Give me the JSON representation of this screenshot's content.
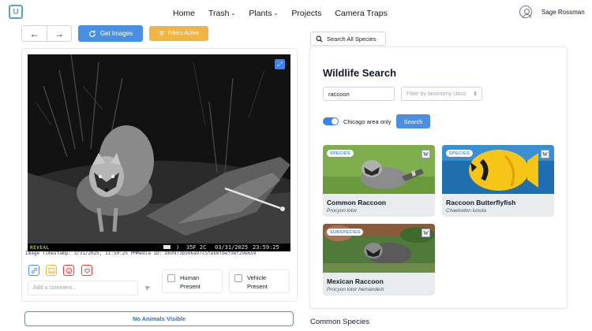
{
  "nav": {
    "logo_text": "U",
    "links": [
      {
        "label": "Home",
        "has_caret": false
      },
      {
        "label": "Trash",
        "has_caret": true
      },
      {
        "label": "Plants",
        "has_caret": true
      },
      {
        "label": "Projects",
        "has_caret": false
      },
      {
        "label": "Camera Traps",
        "has_caret": false
      }
    ],
    "caret_glyph": "⌄",
    "user_name": "Sage Rossman"
  },
  "toolbar": {
    "back_glyph": "←",
    "forward_glyph": "→",
    "get_images_label": "Get Images",
    "filters_label": "Filters Active",
    "get_images_color": "#4a90e2",
    "filters_color": "#f2b544"
  },
  "camera": {
    "brand": "REVEAL",
    "moon_glyph": ")",
    "temperature": "35F 2C",
    "date": "03/31/2025",
    "time": "23:59:25",
    "expand_icon": "expand-icon"
  },
  "image_meta": "Image Timestamp: 3/31/2025, 11:59:25 PMMedia ID: b69971b506a97c5feb8fbef98f29e659",
  "actions": {
    "icons": [
      "link-icon",
      "image-icon",
      "smile-icon",
      "heart-icon"
    ],
    "comment_placeholder": "Add a comment...",
    "human_present": "Human Present",
    "vehicle_present": "Vehicle Present",
    "no_animals_label": "No Animals Visible"
  },
  "right": {
    "search_all_label": "Search All Species",
    "title": "Wildlife Search",
    "query": "raccoon",
    "taxonomy_placeholder": "Filter by taxonomy class",
    "chicago_only_label": "Chicago area only",
    "chicago_only": true,
    "search_label": "Search",
    "wiki_glyph": "W",
    "results": [
      {
        "badge": "SPECIES",
        "name": "Common Raccoon",
        "scientific": "Procyon lotor"
      },
      {
        "badge": "SPECIES",
        "name": "Raccoon Butterflyfish",
        "scientific": "Chaetodon lunula"
      },
      {
        "badge": "SUBSPECIES",
        "name": "Mexican Raccoon",
        "scientific": "Procyon lotor hernandezi"
      }
    ],
    "common_species_label": "Common Species"
  }
}
